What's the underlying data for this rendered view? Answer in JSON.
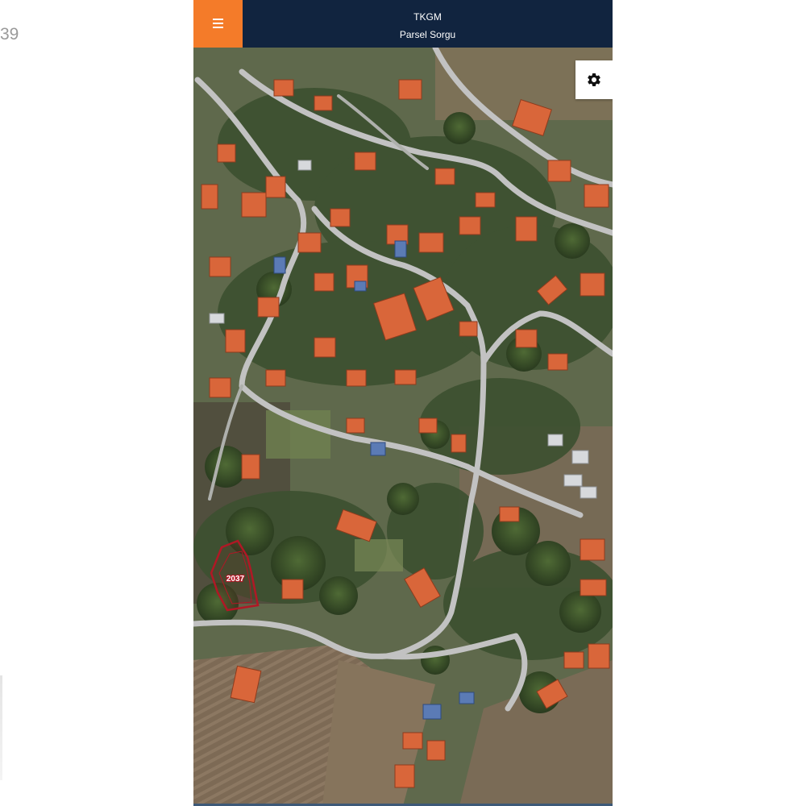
{
  "edge_text": "39",
  "header": {
    "menu_icon": "hamburger-menu-icon",
    "title": "TKGM",
    "subtitle": "Parsel Sorgu"
  },
  "map_controls": {
    "settings_icon": "gear-icon"
  },
  "parcel": {
    "label": "2037"
  },
  "colors": {
    "header_bg": "#11243f",
    "menu_button_bg": "#f47b29",
    "parcel_outline": "#b01825",
    "road": "#c2c2c2",
    "roof": "#d9663a"
  }
}
